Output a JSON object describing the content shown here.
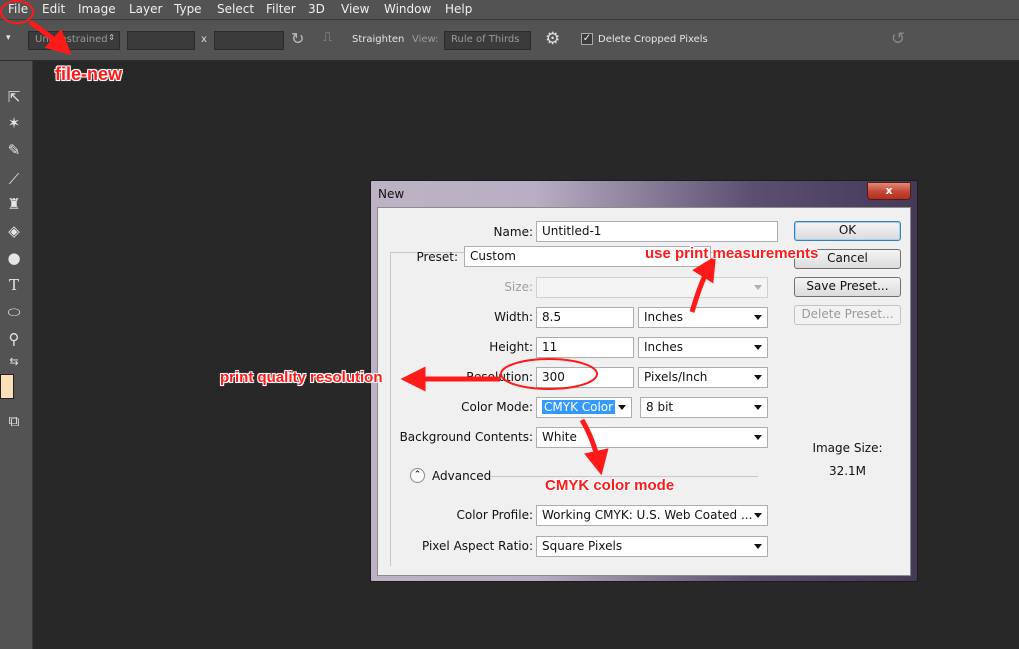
{
  "menu": [
    "File",
    "Edit",
    "Image",
    "Layer",
    "Type",
    "Select",
    "Filter",
    "3D",
    "View",
    "Window",
    "Help"
  ],
  "options_bar": {
    "ratio": "Unconstrained",
    "times": "x",
    "straighten": "Straighten",
    "view_label": "View:",
    "view_value": "Rule of Thirds",
    "delete_cropped": "Delete Cropped Pixels"
  },
  "tools": [
    "move-tool-icon",
    "magic-wand-icon",
    "eyedropper-icon",
    "brush-icon",
    "clone-stamp-icon",
    "paint-bucket-icon",
    "dodge-icon",
    "type-icon",
    "ellipse-icon",
    "zoom-icon",
    "swap-icon",
    "screen-mode-icon"
  ],
  "dialog": {
    "title": "New",
    "close": "x",
    "name_label": "Name:",
    "name_value": "Untitled-1",
    "preset_label": "Preset:",
    "preset_value": "Custom",
    "size_label": "Size:",
    "width_label": "Width:",
    "width_value": "8.5",
    "width_unit": "Inches",
    "height_label": "Height:",
    "height_value": "11",
    "height_unit": "Inches",
    "resolution_label": "Resolution:",
    "resolution_value": "300",
    "resolution_unit": "Pixels/Inch",
    "color_mode_label": "Color Mode:",
    "color_mode_value": "CMYK Color",
    "bit_depth": "8 bit",
    "background_label": "Background Contents:",
    "background_value": "White",
    "advanced": "Advanced",
    "color_profile_label": "Color Profile:",
    "color_profile_value": "Working CMYK:  U.S. Web Coated ...",
    "pixel_aspect_label": "Pixel Aspect Ratio:",
    "pixel_aspect_value": "Square Pixels",
    "ok": "OK",
    "cancel": "Cancel",
    "save_preset": "Save Preset...",
    "delete_preset": "Delete Preset...",
    "image_size_label": "Image Size:",
    "image_size_value": "32.1M"
  },
  "annotations": {
    "file_new": "file-new",
    "print_measurements": "use print measurements",
    "print_resolution": "print quality resolution",
    "cmyk": "CMYK color mode"
  },
  "colors": {
    "annotation": "#ff1a1a",
    "foreground_swatch": "#fbe0b8"
  }
}
